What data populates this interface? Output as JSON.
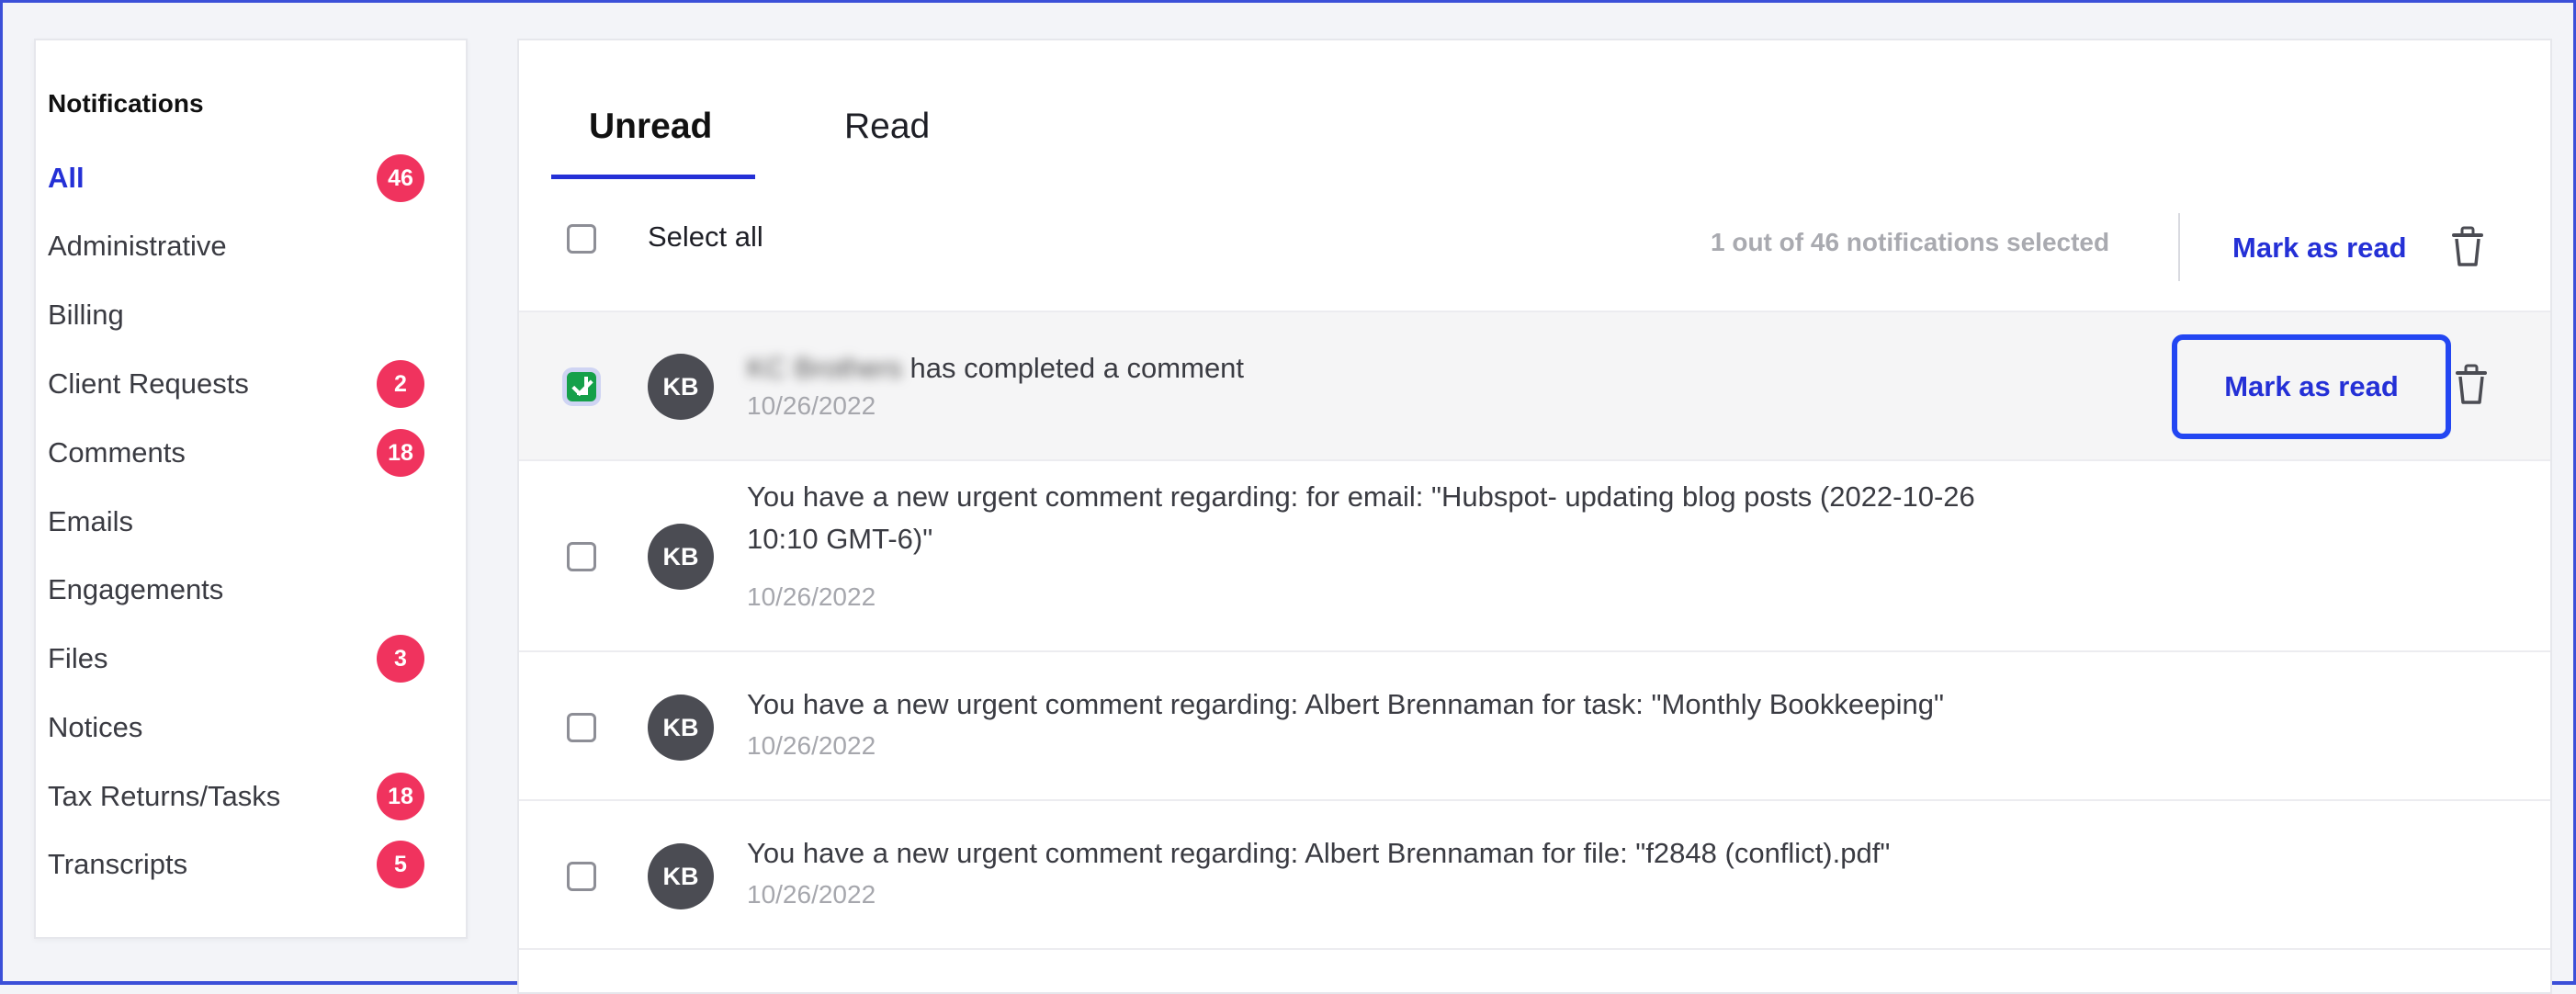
{
  "sidebar": {
    "title": "Notifications",
    "items": [
      {
        "label": "All",
        "badge": "46",
        "active": true
      },
      {
        "label": "Administrative",
        "badge": ""
      },
      {
        "label": "Billing",
        "badge": ""
      },
      {
        "label": "Client Requests",
        "badge": "2"
      },
      {
        "label": "Comments",
        "badge": "18"
      },
      {
        "label": "Emails",
        "badge": ""
      },
      {
        "label": "Engagements",
        "badge": ""
      },
      {
        "label": "Files",
        "badge": "3"
      },
      {
        "label": "Notices",
        "badge": ""
      },
      {
        "label": "Tax Returns/Tasks",
        "badge": "18"
      },
      {
        "label": "Transcripts",
        "badge": "5"
      }
    ]
  },
  "tabs": [
    {
      "label": "Unread",
      "active": true
    },
    {
      "label": "Read",
      "active": false
    }
  ],
  "toolbar": {
    "select_all": "Select all",
    "selection_count": "1 out of 46 notifications selected",
    "mark_as_read": "Mark as read"
  },
  "notifications": [
    {
      "avatar": "KB",
      "sender_blurred": "KC Brothers",
      "message": "has completed a comment",
      "date": "10/26/2022",
      "checked": true,
      "mark_as_read": "Mark as read"
    },
    {
      "avatar": "KB",
      "message_line1": "You have a new urgent comment regarding: for email: \"Hubspot- updating blog posts (2022-10-26",
      "message_line2": "10:10 GMT-6)\"",
      "date": "10/26/2022",
      "checked": false
    },
    {
      "avatar": "KB",
      "message": "You have a new urgent comment regarding: Albert Brennaman for task: \"Monthly Bookkeeping\"",
      "date": "10/26/2022",
      "checked": false
    },
    {
      "avatar": "KB",
      "message": "You have a new urgent comment regarding: Albert Brennaman for file: \"f2848 (conflict).pdf\"",
      "date": "10/26/2022",
      "checked": false
    }
  ],
  "colors": {
    "accent": "#2430d6",
    "badge": "#f0335e",
    "checked": "#15a04a",
    "avatar": "#4b4c53"
  }
}
